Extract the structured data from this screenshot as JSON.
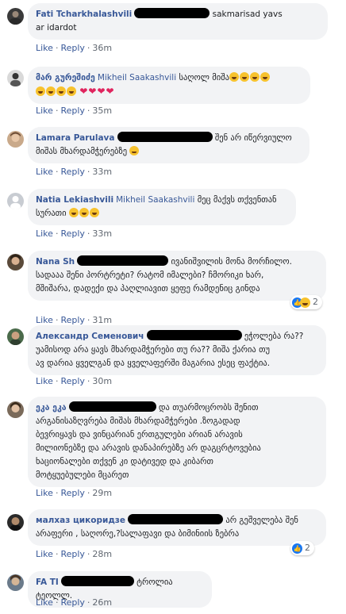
{
  "meta_labels": {
    "like": "Like",
    "reply": "Reply",
    "separator": "·"
  },
  "colors": {
    "link": "#385898",
    "bubble_bg": "#f2f3f5",
    "meta": "#606770"
  },
  "comments": [
    {
      "author": "Fati Tcharkhalashvili",
      "line1_after": "sakmarisad yavs",
      "line2": "ar idardot",
      "time": "36m"
    },
    {
      "author": "მარ გურეშიძე",
      "mention": "Mikheil Saakashvili",
      "text": "საღოლ მიშა",
      "time": "35m"
    },
    {
      "author": "Lamara Parulava",
      "line1_after": "შენ არ იწერვიულო",
      "line2": "მიშას მხარდამჭერებზე",
      "time": "33m"
    },
    {
      "author": "Natia Lekiashvili",
      "mention": "Mikheil Saakashvili",
      "text": "მეც მაქვს თქვენთან",
      "line2": "სურათი",
      "time": "33m"
    },
    {
      "author": "Nana Sh",
      "line1_after": "ივანიშვილის მონა მორჩილო.",
      "line2": "სადააა შენი პორტრეტი? რატომ იმალები? ჩმორიკი ხარ,",
      "line3": "მშიშარა, დადექი და პაღლიავით ყეფე რამდენიც გინდა",
      "time": "31m",
      "reaction_count": "2"
    },
    {
      "author": "Александр Семенович",
      "line1_after": "ეჭოლება რა??",
      "line2": "უამისოდ არა ყავს მხარდამჭერები თუ რა?? მიშა ქარია თუ",
      "line3": "ავ დარია ყველგან და ყველაფერში მაგარია ესეც ფაქტია.",
      "time": "30m"
    },
    {
      "author": "ეკა ეკა",
      "line1_after": "და თუარმოცრობს შენით",
      "line2": "არგანისაზღვრება მიშას მხარდამჭერები .ზოგადად",
      "line3": "ბევრიყავს და ვინცარიან ერთგულები არიან არავის",
      "line4": "მილიონებზე და არავის დანაპირებზე არ დაგცრტოვებია",
      "line5": "ხაციონალები თქვენ კი დატივედ და კიბართ",
      "line6": "მოტყუებულები მცარეთ",
      "time": "29m"
    },
    {
      "author": "малхаз цикоридзе",
      "line1_after": "არ გეშველება შენ",
      "line2": "არაფერი , საღორე,?სალაფავი და ბიმინიის ზებრა",
      "time": "28m",
      "reaction_count": "2"
    },
    {
      "author": "FA TI",
      "line1_after": "ტროლია ტეოლლ.",
      "time": "26m"
    }
  ]
}
